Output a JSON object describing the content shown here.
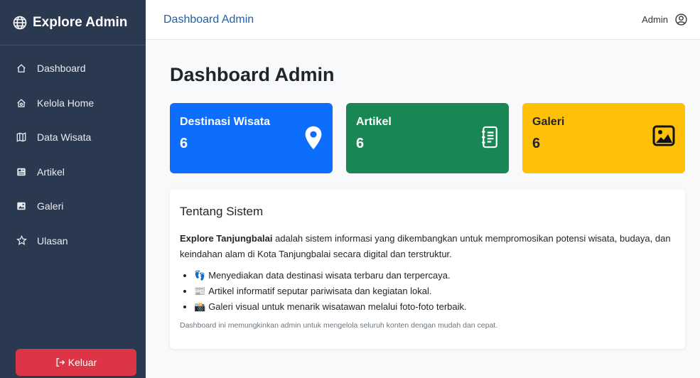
{
  "brand": {
    "title": "Explore Admin"
  },
  "sidebar": {
    "items": [
      {
        "label": "Dashboard",
        "icon": "home-icon"
      },
      {
        "label": "Kelola Home",
        "icon": "house-gear-icon"
      },
      {
        "label": "Data Wisata",
        "icon": "map-icon"
      },
      {
        "label": "Artikel",
        "icon": "newspaper-icon"
      },
      {
        "label": "Galeri",
        "icon": "image-icon"
      },
      {
        "label": "Ulasan",
        "icon": "star-icon"
      }
    ],
    "logout_label": "Keluar"
  },
  "topbar": {
    "title": "Dashboard Admin",
    "user": "Admin"
  },
  "main": {
    "title": "Dashboard Admin",
    "cards": [
      {
        "label": "Destinasi Wisata",
        "value": "6",
        "color": "#0d6efd",
        "icon": "map-pin-icon"
      },
      {
        "label": "Artikel",
        "value": "6",
        "color": "#198754",
        "icon": "journal-icon"
      },
      {
        "label": "Galeri",
        "value": "6",
        "color": "#ffc107",
        "icon": "picture-icon"
      }
    ],
    "about": {
      "heading": "Tentang Sistem",
      "desc_bold": "Explore Tanjungbalai",
      "desc_rest": " adalah sistem informasi yang dikembangkan untuk mempromosikan potensi wisata, budaya, dan keindahan alam di Kota Tanjungbalai secara digital dan terstruktur.",
      "bullets": [
        {
          "emoji": "👣",
          "text": "Menyediakan data destinasi wisata terbaru dan terpercaya."
        },
        {
          "emoji": "📰",
          "text": "Artikel informatif seputar pariwisata dan kegiatan lokal."
        },
        {
          "emoji": "📸",
          "text": "Galeri visual untuk menarik wisatawan melalui foto-foto terbaik."
        }
      ],
      "note": "Dashboard ini memungkinkan admin untuk mengelola seluruh konten dengan mudah dan cepat."
    }
  }
}
